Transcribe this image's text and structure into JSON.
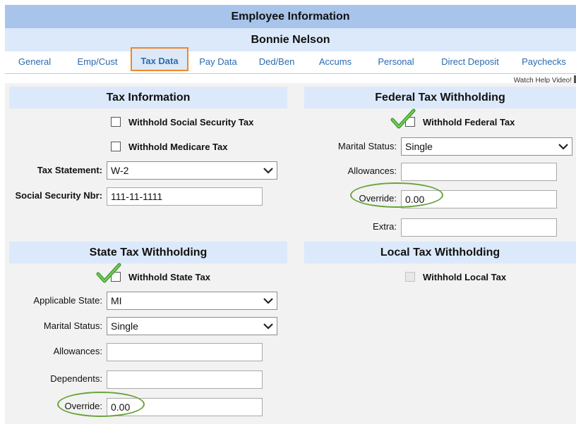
{
  "header": {
    "title": "Employee Information",
    "employee_name": "Bonnie Nelson"
  },
  "tabs": [
    {
      "label": "General"
    },
    {
      "label": "Emp/Cust"
    },
    {
      "label": "Tax Data"
    },
    {
      "label": "Pay Data"
    },
    {
      "label": "Ded/Ben"
    },
    {
      "label": "Accums"
    },
    {
      "label": "Personal"
    },
    {
      "label": "Direct Deposit"
    },
    {
      "label": "Paychecks"
    }
  ],
  "active_tab": "Tax Data",
  "help_link": "Watch Help Video!",
  "tax_information": {
    "title": "Tax Information",
    "withhold_ss_label": "Withhold Social Security Tax",
    "withhold_ss_checked": false,
    "withhold_medicare_label": "Withhold Medicare Tax",
    "withhold_medicare_checked": false,
    "tax_statement_label": "Tax Statement:",
    "tax_statement_value": "W-2",
    "ssn_label": "Social Security Nbr:",
    "ssn_value": "111-11-1111"
  },
  "federal": {
    "title": "Federal Tax Withholding",
    "withhold_label": "Withhold Federal Tax",
    "withhold_checked": true,
    "marital_label": "Marital Status:",
    "marital_value": "Single",
    "allowances_label": "Allowances:",
    "allowances_value": "",
    "override_label": "Override:",
    "override_value": "0.00",
    "extra_label": "Extra:",
    "extra_value": ""
  },
  "state": {
    "title": "State Tax Withholding",
    "withhold_label": "Withhold State Tax",
    "withhold_checked": true,
    "state_label": "Applicable State:",
    "state_value": "MI",
    "marital_label": "Marital Status:",
    "marital_value": "Single",
    "allowances_label": "Allowances:",
    "allowances_value": "",
    "dependents_label": "Dependents:",
    "dependents_value": "",
    "override_label": "Override:",
    "override_value": "0.00"
  },
  "local": {
    "title": "Local Tax Withholding",
    "withhold_label": "Withhold Local Tax",
    "withhold_checked": false,
    "withhold_disabled": true
  },
  "colors": {
    "title_bar": "#a8c4ea",
    "name_bar": "#dbe9fb",
    "tab_text": "#2a6ab0",
    "active_tab_border": "#f0862a",
    "highlight_oval": "#6aa33a",
    "check_green": "#4caf3a"
  }
}
